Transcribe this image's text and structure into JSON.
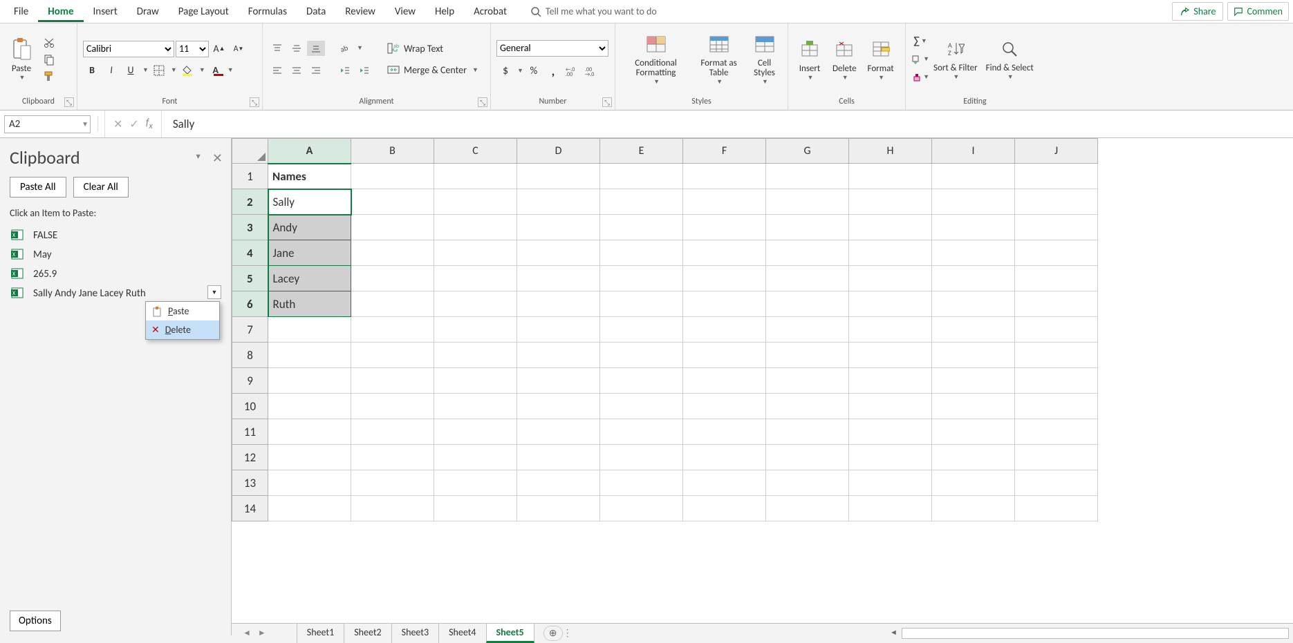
{
  "menubar": {
    "tabs": [
      "File",
      "Home",
      "Insert",
      "Draw",
      "Page Layout",
      "Formulas",
      "Data",
      "Review",
      "View",
      "Help",
      "Acrobat"
    ],
    "active": "Home",
    "tell_me": "Tell me what you want to do",
    "share": "Share",
    "comment": "Commen"
  },
  "ribbon": {
    "clipboard": {
      "label": "Clipboard",
      "paste": "Paste"
    },
    "font": {
      "label": "Font",
      "name": "Calibri",
      "size": "11"
    },
    "alignment": {
      "label": "Alignment",
      "wrap": "Wrap Text",
      "merge": "Merge & Center"
    },
    "number": {
      "label": "Number",
      "format": "General"
    },
    "styles": {
      "label": "Styles",
      "cond": "Conditional Formatting",
      "table": "Format as Table",
      "cell": "Cell Styles"
    },
    "cells": {
      "label": "Cells",
      "insert": "Insert",
      "delete": "Delete",
      "format": "Format"
    },
    "editing": {
      "label": "Editing",
      "sortfilter": "Sort & Filter",
      "findselect": "Find & Select"
    }
  },
  "formula_bar": {
    "name_box": "A2",
    "fx_value": "Sally"
  },
  "clipboard_pane": {
    "title": "Clipboard",
    "paste_all": "Paste All",
    "clear_all": "Clear All",
    "hint": "Click an Item to Paste:",
    "items": [
      {
        "text": "FALSE"
      },
      {
        "text": "May"
      },
      {
        "text": "265.9"
      },
      {
        "text": "Sally Andy Jane Lacey Ruth"
      }
    ],
    "context_menu": {
      "paste": "Paste",
      "delete": "Delete"
    },
    "options": "Options"
  },
  "grid": {
    "columns": [
      "A",
      "B",
      "C",
      "D",
      "E",
      "F",
      "G",
      "H",
      "I",
      "J"
    ],
    "rows": [
      1,
      2,
      3,
      4,
      5,
      6,
      7,
      8,
      9,
      10,
      11,
      12,
      13,
      14
    ],
    "data": {
      "A1": "Names",
      "A2": "Sally",
      "A3": "Andy",
      "A4": "Jane",
      "A5": "Lacey",
      "A6": "Ruth"
    },
    "selected_range": "A2:A6",
    "active_cell": "A2"
  },
  "sheets": {
    "tabs": [
      "Sheet1",
      "Sheet2",
      "Sheet3",
      "Sheet4",
      "Sheet5"
    ],
    "active": "Sheet5"
  }
}
